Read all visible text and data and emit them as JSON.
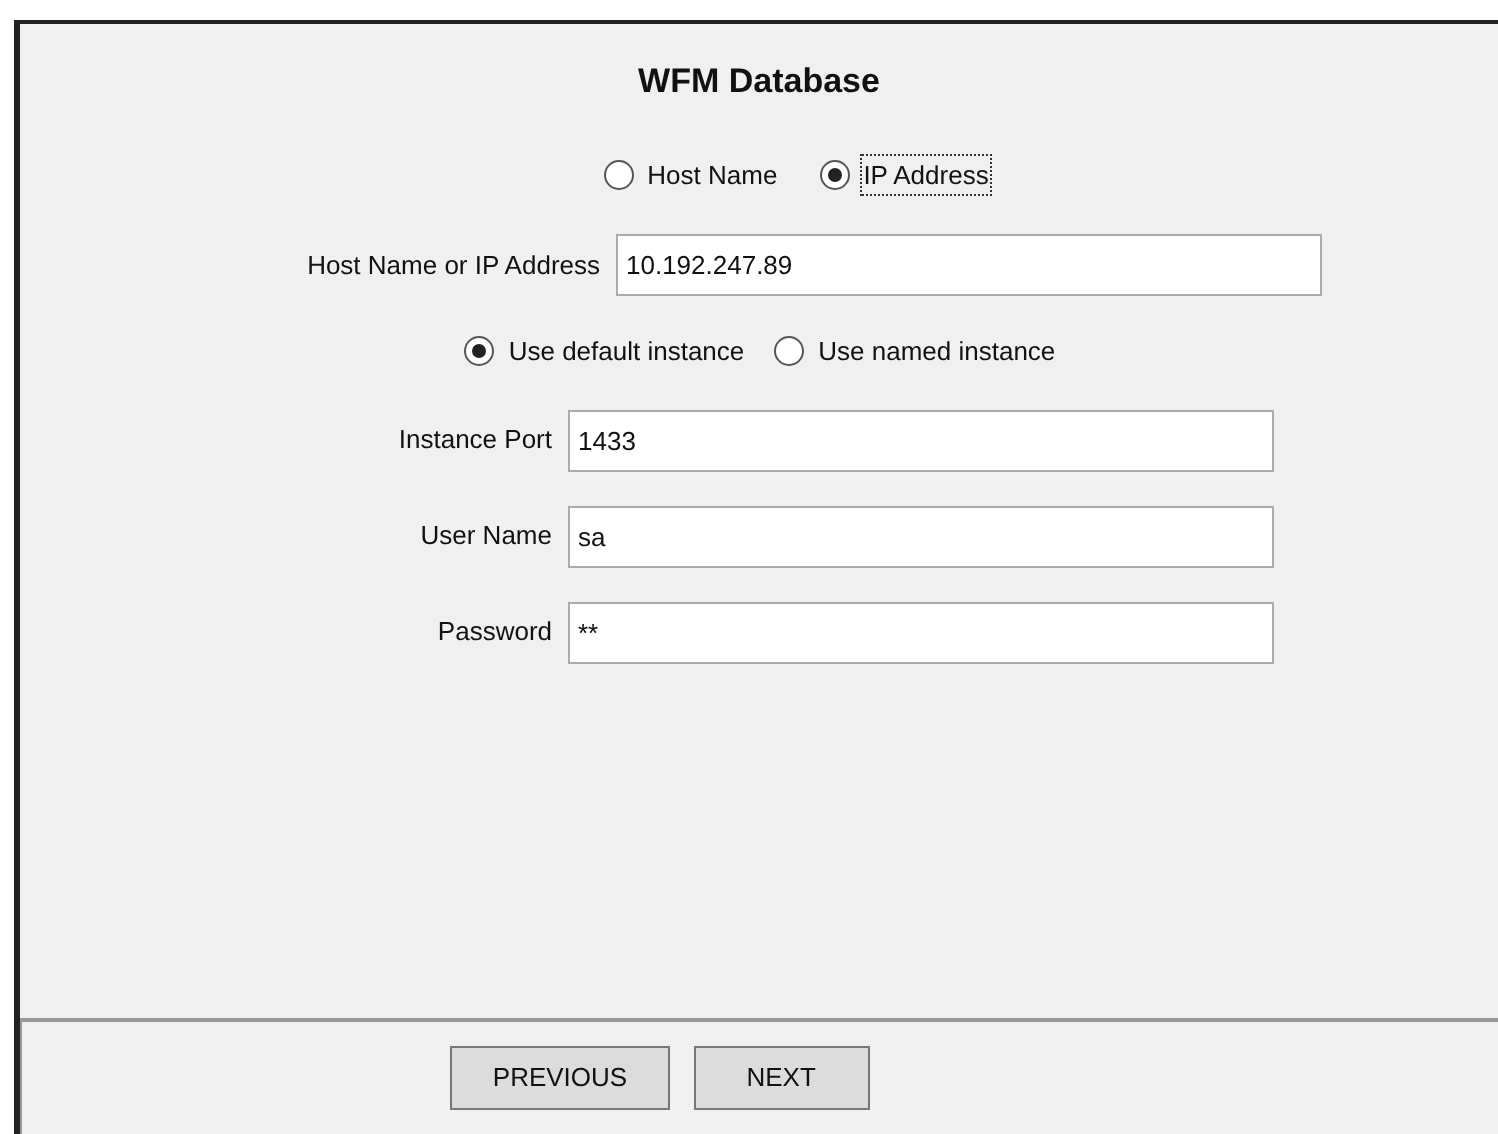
{
  "title": "WFM Database",
  "address_mode": [
    {
      "label": "Host Name",
      "selected": false,
      "focused": false
    },
    {
      "label": "IP Address",
      "selected": true,
      "focused": true
    }
  ],
  "host_field": {
    "label": "Host Name or IP Address",
    "value": "10.192.247.89"
  },
  "instance_mode": [
    {
      "label": "Use default instance",
      "selected": true,
      "focused": false
    },
    {
      "label": "Use named instance",
      "selected": false,
      "focused": false
    }
  ],
  "fields": [
    {
      "label": "Instance Port",
      "value": "1433"
    },
    {
      "label": "User Name",
      "value": "sa"
    },
    {
      "label": "Password",
      "value": "**"
    }
  ],
  "buttons": [
    "PREVIOUS",
    "NEXT"
  ]
}
